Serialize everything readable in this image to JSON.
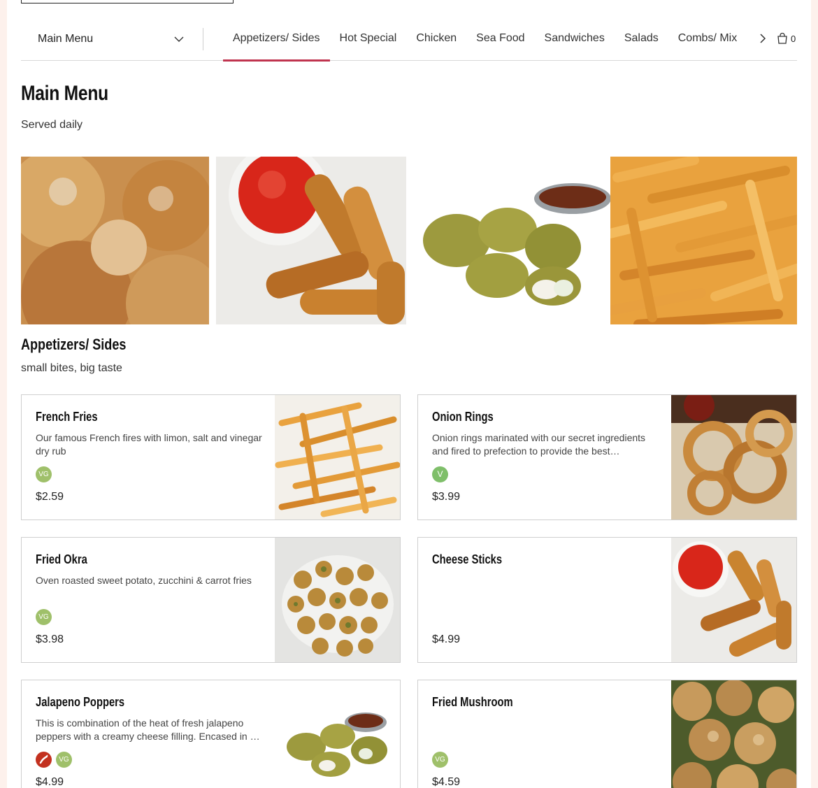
{
  "menu_selector": {
    "label": "Main Menu"
  },
  "tabs": [
    {
      "label": "Appetizers/ Sides",
      "active": true
    },
    {
      "label": "Hot Special",
      "active": false
    },
    {
      "label": "Chicken",
      "active": false
    },
    {
      "label": "Sea Food",
      "active": false
    },
    {
      "label": "Sandwiches",
      "active": false
    },
    {
      "label": "Salads",
      "active": false
    },
    {
      "label": "Combs/ Mix",
      "active": false
    }
  ],
  "cart": {
    "count": "0"
  },
  "menu": {
    "title": "Main Menu",
    "subtitle": "Served daily"
  },
  "section": {
    "title": "Appetizers/ Sides",
    "subtitle": "small bites, big taste"
  },
  "items": [
    {
      "name": "French Fries",
      "description": "Our famous French fires with limon, salt and vinegar dry rub",
      "badges": [
        "VG"
      ],
      "price": "$2.59"
    },
    {
      "name": "Onion Rings",
      "description": "Onion rings marinated with our secret ingredients and fired to prefection to provide the best…",
      "badges": [
        "V"
      ],
      "price": "$3.99"
    },
    {
      "name": "Fried Okra",
      "description": "Oven roasted sweet potato, zucchini & carrot fries",
      "badges": [
        "VG"
      ],
      "price": "$3.98"
    },
    {
      "name": "Cheese Sticks",
      "description": "",
      "badges": [],
      "price": "$4.99"
    },
    {
      "name": "Jalapeno Poppers",
      "description": "This is combination of the heat of fresh jalapeno peppers with a creamy cheese filling. Encased in …",
      "badges": [
        "spicy",
        "VG"
      ],
      "price": "$4.99"
    },
    {
      "name": "Fried Mushroom",
      "description": "",
      "badges": [
        "VG"
      ],
      "price": "$4.59"
    }
  ],
  "colors": {
    "accent": "#c0344f",
    "vg_badge": "#9fc06a",
    "v_badge": "#7fbf6a",
    "spicy_badge": "#c3311f"
  }
}
